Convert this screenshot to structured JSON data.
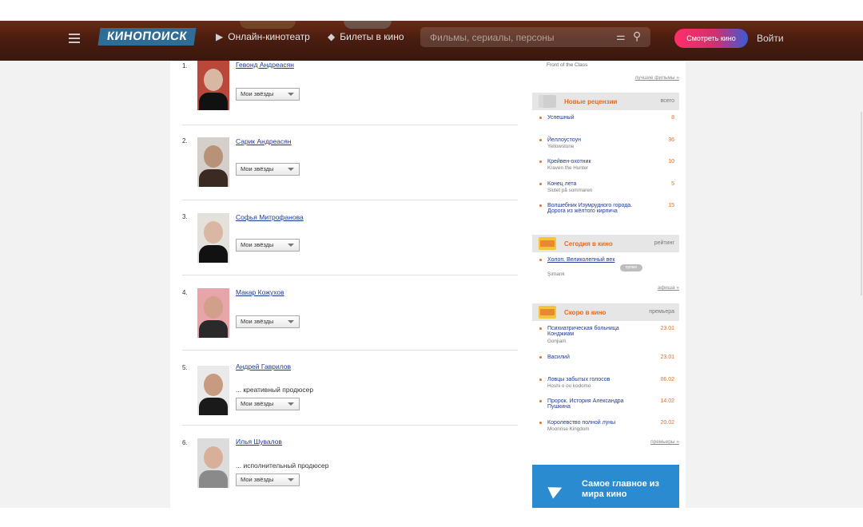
{
  "header": {
    "logo": "КИНОПОИСК",
    "nav": [
      {
        "label": "Онлайн-кинотеатр",
        "icon": "play-icon"
      },
      {
        "label": "Билеты в кино",
        "icon": "ticket-icon"
      }
    ],
    "search_placeholder": "Фильмы, сериалы, персоны",
    "watch_button": "Смотреть кино",
    "login": "Войти"
  },
  "people": [
    {
      "num": "1.",
      "name": "Гевонд Андреасян",
      "role": "",
      "dropdown": "Мои звёзды"
    },
    {
      "num": "2.",
      "name": "Сарик Андреасян",
      "role": "",
      "dropdown": "Мои звёзды"
    },
    {
      "num": "3.",
      "name": "Софья Митрофанова",
      "role": "",
      "dropdown": "Мои звёзды"
    },
    {
      "num": "4.",
      "name": "Макар Кожухов",
      "role": "",
      "dropdown": "Мои звёзды"
    },
    {
      "num": "5.",
      "name": "Андрей Гаврилов",
      "role": "... креативный продюсер",
      "dropdown": "Мои звёзды"
    },
    {
      "num": "6.",
      "name": "Илья Шувалов",
      "role": "... исполнительный продюсер",
      "dropdown": "Мои звёзды"
    }
  ],
  "sidebar": {
    "top_item": "Front of the Class",
    "best_films_link": "лучшие фильмы »",
    "reviews": {
      "title": "Новые рецензии",
      "right": "всего",
      "items": [
        {
          "title": "Успешный",
          "sub": "",
          "count": "8"
        },
        {
          "title": "Йеллоустоун",
          "sub": "Yellowstone",
          "count": "36"
        },
        {
          "title": "Крейвен-охотник",
          "sub": "Kraven the Hunter",
          "count": "10"
        },
        {
          "title": "Конец лета",
          "sub": "Slutet på sommaren",
          "count": "5"
        },
        {
          "title": "Волшебник Изумрудного города. Дорога из жёлтого кирпича",
          "sub": "",
          "count": "15"
        }
      ]
    },
    "today": {
      "title": "Сегодня в кино",
      "right": "рейтинг",
      "items": [
        {
          "title": "Холоп. Великолепный век",
          "sub": "Şımarık",
          "badge": "промо"
        }
      ],
      "more": "афиша »"
    },
    "soon": {
      "title": "Скоро в кино",
      "right": "премьера",
      "items": [
        {
          "title": "Психиатрическая больница Конджиам",
          "sub": "Gonjiam",
          "date": "23.01"
        },
        {
          "title": "Василий",
          "sub": "",
          "date": "23.01"
        },
        {
          "title": "Ловцы забытых голосов",
          "sub": "Hoshi o ou kodomo",
          "date": "06.02"
        },
        {
          "title": "Пророк. История Александра Пушкина",
          "sub": "",
          "date": "14.02"
        },
        {
          "title": "Королевство полной луны",
          "sub": "Moonrise Kingdom",
          "date": "20.02"
        }
      ],
      "more": "премьеры »"
    },
    "telegram_text": "Самое главное из мира кино"
  }
}
